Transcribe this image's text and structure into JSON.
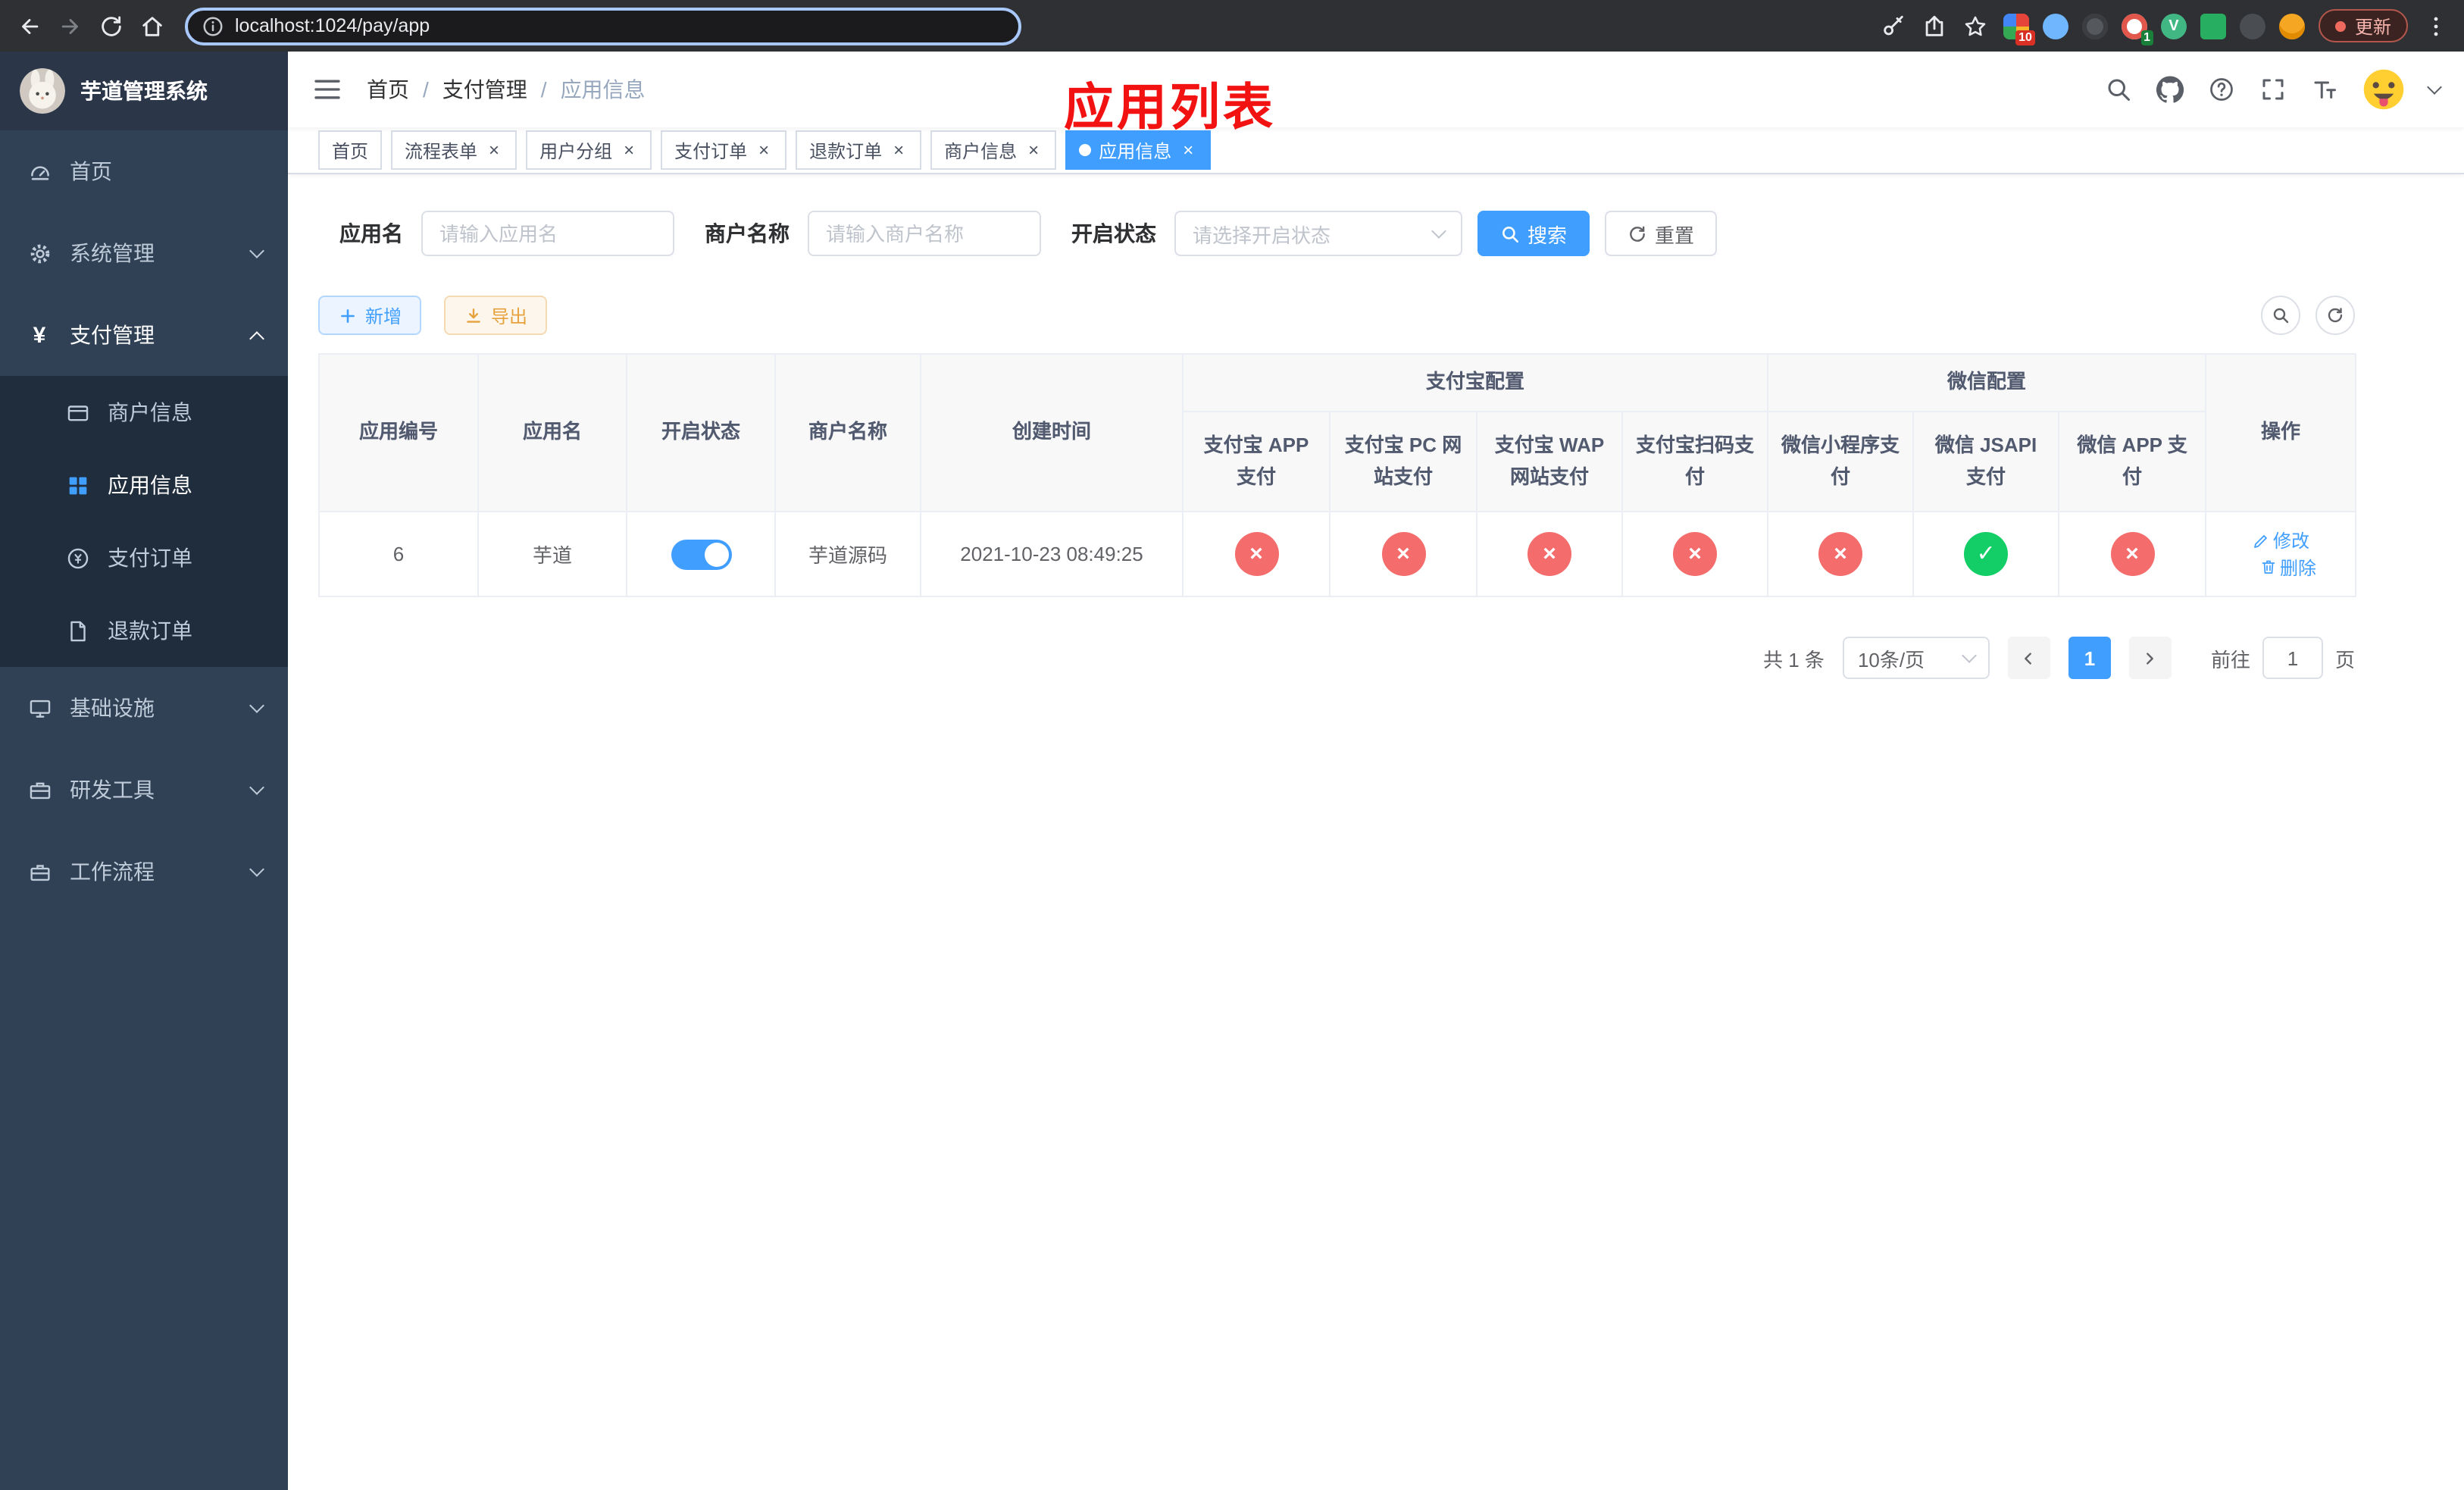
{
  "browser": {
    "url": "localhost:1024/pay/app",
    "update_label": "更新",
    "ext_badge_red": "10",
    "ext_badge_green": "1"
  },
  "annotation": "应用列表",
  "sidebar": {
    "app_title": "芋道管理系统",
    "home": "首页",
    "system": "系统管理",
    "payment": "支付管理",
    "merchant_info": "商户信息",
    "app_info": "应用信息",
    "pay_order": "支付订单",
    "refund_order": "退款订单",
    "infrastructure": "基础设施",
    "dev_tools": "研发工具",
    "workflow": "工作流程"
  },
  "breadcrumb": {
    "items": [
      "首页",
      "支付管理",
      "应用信息"
    ],
    "separator": "/"
  },
  "tabs": [
    {
      "label": "首页"
    },
    {
      "label": "流程表单"
    },
    {
      "label": "用户分组"
    },
    {
      "label": "支付订单"
    },
    {
      "label": "退款订单"
    },
    {
      "label": "商户信息"
    },
    {
      "label": "应用信息"
    }
  ],
  "filters": {
    "app_name_label": "应用名",
    "app_name_placeholder": "请输入应用名",
    "merchant_label": "商户名称",
    "merchant_placeholder": "请输入商户名称",
    "status_label": "开启状态",
    "status_placeholder": "请选择开启状态",
    "search_label": "搜索",
    "reset_label": "重置"
  },
  "toolbar": {
    "add_label": "新增",
    "export_label": "导出"
  },
  "table": {
    "headers": {
      "app_id": "应用编号",
      "app_name": "应用名",
      "status": "开启状态",
      "merchant": "商户名称",
      "created": "创建时间",
      "alipay_group": "支付宝配置",
      "wechat_group": "微信配置",
      "alipay_app": "支付宝 APP 支付",
      "alipay_pc": "支付宝 PC 网站支付",
      "alipay_wap": "支付宝 WAP 网站支付",
      "alipay_qr": "支付宝扫码支付",
      "wx_mini": "微信小程序支付",
      "wx_jsapi": "微信 JSAPI 支付",
      "wx_app": "微信 APP 支付",
      "actions": "操作"
    },
    "rows": [
      {
        "app_id": "6",
        "app_name": "芋道",
        "enabled": true,
        "merchant": "芋道源码",
        "created": "2021-10-23 08:49:25",
        "channels": [
          false,
          false,
          false,
          false,
          false,
          true,
          false
        ],
        "edit_label": "修改",
        "delete_label": "删除"
      }
    ]
  },
  "pagination": {
    "total": "共 1 条",
    "page_size": "10条/页",
    "current_page": "1",
    "goto_label": "前往",
    "goto_value": "1",
    "page_unit": "页"
  },
  "colors": {
    "accent": "#409EFF",
    "danger": "#f56c6c",
    "success": "#13ce66"
  }
}
